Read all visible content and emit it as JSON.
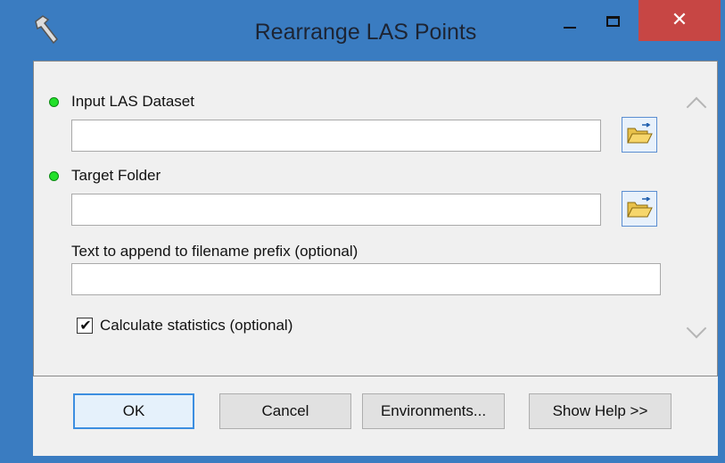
{
  "window": {
    "title": "Rearrange LAS Points",
    "app_icon": "hammer-icon",
    "controls": {
      "minimize": "minimize-icon",
      "maximize": "maximize-icon",
      "close_label": "✕"
    }
  },
  "parameters": {
    "input_las": {
      "label": "Input LAS Dataset",
      "value": "",
      "required": true
    },
    "target_folder": {
      "label": "Target Folder",
      "value": "",
      "required": true
    },
    "prefix_text": {
      "label": "Text to append to filename prefix (optional)",
      "value": ""
    },
    "calc_stats": {
      "label": "Calculate statistics (optional)",
      "checked": true,
      "mark": "✔"
    }
  },
  "buttons": {
    "ok": "OK",
    "cancel": "Cancel",
    "environments": "Environments...",
    "show_help": "Show Help >>"
  },
  "colors": {
    "required_dot": "#22e02a",
    "close_button": "#c74644",
    "window_frame": "#3a7cc1"
  }
}
